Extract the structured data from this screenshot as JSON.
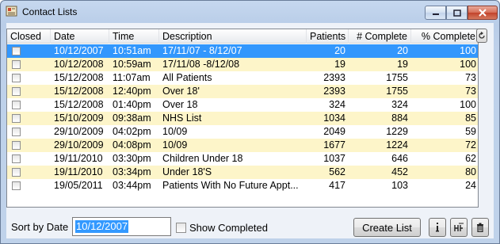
{
  "window": {
    "title": "Contact Lists"
  },
  "grid": {
    "columns": [
      {
        "label": "Closed"
      },
      {
        "label": "Date"
      },
      {
        "label": "Time"
      },
      {
        "label": "Description"
      },
      {
        "label": "Patients"
      },
      {
        "label": "# Complete"
      },
      {
        "label": "% Complete"
      }
    ],
    "rows": [
      {
        "date": "10/12/2007",
        "time": "10:51am",
        "description": "17/11/07 - 8/12/07",
        "patients": "20",
        "complete": "20",
        "pct": "100",
        "selected": true
      },
      {
        "date": "10/12/2008",
        "time": "10:59am",
        "description": "17/11/08 -8/12/08",
        "patients": "19",
        "complete": "19",
        "pct": "100",
        "selected": false
      },
      {
        "date": "15/12/2008",
        "time": "11:07am",
        "description": "All Patients",
        "patients": "2393",
        "complete": "1755",
        "pct": "73",
        "selected": false
      },
      {
        "date": "15/12/2008",
        "time": "12:40pm",
        "description": "Over 18'",
        "patients": "2393",
        "complete": "1755",
        "pct": "73",
        "selected": false
      },
      {
        "date": "15/12/2008",
        "time": "01:40pm",
        "description": "Over 18",
        "patients": "324",
        "complete": "324",
        "pct": "100",
        "selected": false
      },
      {
        "date": "15/10/2009",
        "time": "09:38am",
        "description": "NHS List",
        "patients": "1034",
        "complete": "884",
        "pct": "85",
        "selected": false
      },
      {
        "date": "29/10/2009",
        "time": "04:02pm",
        "description": "10/09",
        "patients": "2049",
        "complete": "1229",
        "pct": "59",
        "selected": false
      },
      {
        "date": "29/10/2009",
        "time": "04:08pm",
        "description": "10/09",
        "patients": "1677",
        "complete": "1224",
        "pct": "72",
        "selected": false
      },
      {
        "date": "19/11/2010",
        "time": "03:30pm",
        "description": "Children Under 18",
        "patients": "1037",
        "complete": "646",
        "pct": "62",
        "selected": false
      },
      {
        "date": "19/11/2010",
        "time": "03:34pm",
        "description": "Under 18'S",
        "patients": "562",
        "complete": "452",
        "pct": "80",
        "selected": false
      },
      {
        "date": "19/05/2011",
        "time": "03:44pm",
        "description": "Patients With No Future Appt...",
        "patients": "417",
        "complete": "103",
        "pct": "24",
        "selected": false
      }
    ]
  },
  "footer": {
    "sort_label": "Sort by Date",
    "sort_value": "10/12/2007",
    "show_completed_label": "Show Completed",
    "create_list_label": "Create List",
    "info_icon": "info-icon",
    "edit_icon": "edit-icon",
    "delete_icon": "trash-icon"
  },
  "colors": {
    "selected_row": "#3297fd",
    "alt_row": "#fdf5c9"
  }
}
